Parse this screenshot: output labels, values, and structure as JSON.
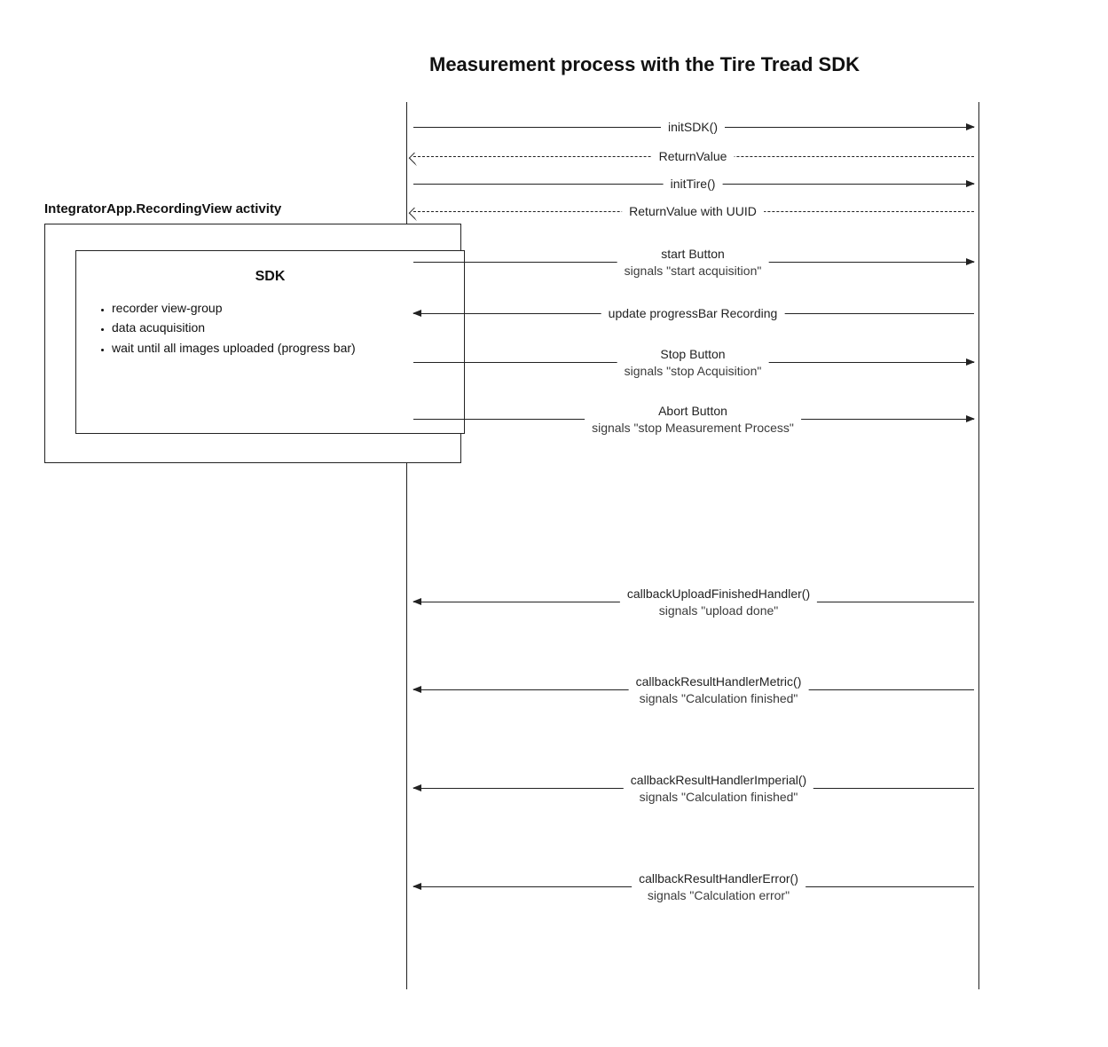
{
  "title": "Measurement process with the Tire Tread SDK",
  "actor": {
    "label": "IntegratorApp.RecordingView activity",
    "sdk": {
      "title": "SDK",
      "items": [
        "recorder view-group",
        "data acuquisition",
        "wait until all images uploaded (progress bar)"
      ]
    }
  },
  "messages": {
    "m1": "initSDK()",
    "m2": "ReturnValue",
    "m3": "initTire()",
    "m4": "ReturnValue with UUID",
    "m5_l1": "start Button",
    "m5_l2": "signals \"start acquisition\"",
    "m6": "update progressBar Recording",
    "m7_l1": "Stop Button",
    "m7_l2": "signals \"stop Acquisition\"",
    "m8_l1": "Abort Button",
    "m8_l2": "signals \"stop Measurement Process\"",
    "m9_l1": "callbackUploadFinishedHandler()",
    "m9_l2": "signals \"upload done\"",
    "m10_l1": "callbackResultHandlerMetric()",
    "m10_l2": "signals \"Calculation finished\"",
    "m11_l1": "callbackResultHandlerImperial()",
    "m11_l2": "signals \"Calculation finished\"",
    "m12_l1": "callbackResultHandlerError()",
    "m12_l2": "signals \"Calculation error\""
  }
}
